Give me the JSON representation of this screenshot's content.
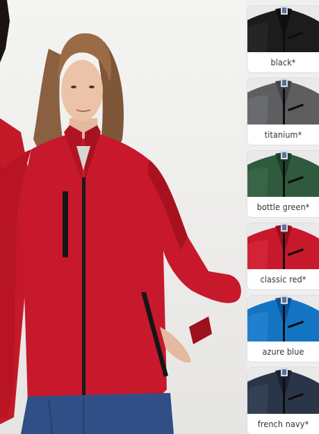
{
  "product": {
    "image_icon": "woman-wearing-red-softshell-jacket"
  },
  "swatches": [
    {
      "label": "black*",
      "color": "#1c1c1c",
      "shade": "#0f0f0f",
      "light": "#2e2e2e"
    },
    {
      "label": "titanium*",
      "color": "#5c5e60",
      "shade": "#44464a",
      "light": "#75777a"
    },
    {
      "label": "bottle green*",
      "color": "#2f5a3e",
      "shade": "#1e3f2a",
      "light": "#41704f"
    },
    {
      "label": "classic red*",
      "color": "#c8182c",
      "shade": "#951020",
      "light": "#dc3040"
    },
    {
      "label": "azure blue",
      "color": "#1474c4",
      "shade": "#0b5496",
      "light": "#2c8ad6"
    },
    {
      "label": "french navy*",
      "color": "#2b3548",
      "shade": "#1a2233",
      "light": "#3c4a60"
    }
  ]
}
